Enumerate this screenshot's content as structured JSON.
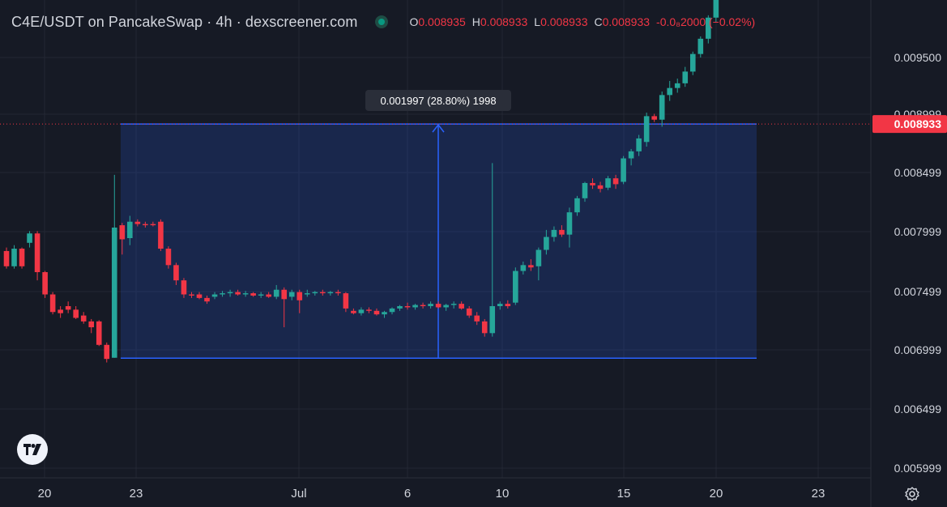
{
  "header": {
    "title": "C4E/USDT on PancakeSwap · 4h · dexscreener.com",
    "ohlc": {
      "o_label": "O",
      "o": "0.008935",
      "h_label": "H",
      "h": "0.008933",
      "l_label": "L",
      "l": "0.008933",
      "c_label": "C",
      "c": "0.008933",
      "change": "-0.0₈2000 (−0.02%)"
    }
  },
  "measure_label": "0.001997 (28.80%) 1998",
  "price_badge": "0.008933",
  "colors": {
    "background": "#161a25",
    "up": "#26a69a",
    "down": "#f23645",
    "measure": "#2962ff",
    "badge": "#f23645"
  },
  "icons": {
    "logo": "tradingview-logo-icon",
    "settings": "gear-icon"
  },
  "chart_data": {
    "type": "candlestick",
    "y_ticks": [
      "0.009500",
      "0.008999",
      "0.008499",
      "0.007999",
      "0.007499",
      "0.006999",
      "0.006499",
      "0.005999"
    ],
    "x_ticks": [
      "20",
      "23",
      "Jul",
      "6",
      "10",
      "15",
      "20",
      "23"
    ],
    "last_price": 0.008933,
    "measure": {
      "low": 0.006936,
      "high": 0.008933,
      "change": 0.001997,
      "percent": 28.8,
      "bars": 1998
    },
    "candles": [
      [
        0.00785,
        0.00788,
        0.0077,
        0.00772
      ],
      [
        0.00772,
        0.0079,
        0.0077,
        0.00787
      ],
      [
        0.00787,
        0.00788,
        0.0077,
        0.00772
      ],
      [
        0.00792,
        0.00802,
        0.00788,
        0.008
      ],
      [
        0.008,
        0.00802,
        0.0076,
        0.00767
      ],
      [
        0.00767,
        0.00768,
        0.00745,
        0.00748
      ],
      [
        0.00748,
        0.0075,
        0.00731,
        0.00733
      ],
      [
        0.00735,
        0.00738,
        0.00728,
        0.00732
      ],
      [
        0.00738,
        0.00742,
        0.00732,
        0.00735
      ],
      [
        0.00735,
        0.00738,
        0.00727,
        0.00728
      ],
      [
        0.0073,
        0.00733,
        0.00723,
        0.00725
      ],
      [
        0.00725,
        0.00727,
        0.00715,
        0.0072
      ],
      [
        0.00725,
        0.00726,
        0.00704,
        0.00705
      ],
      [
        0.00705,
        0.00707,
        0.0069,
        0.00693
      ],
      [
        0.00694,
        0.0085,
        0.00694,
        0.00805
      ],
      [
        0.00807,
        0.00809,
        0.00782,
        0.00795
      ],
      [
        0.00796,
        0.00815,
        0.0079,
        0.0081
      ],
      [
        0.0081,
        0.00812,
        0.00806,
        0.00808
      ],
      [
        0.00808,
        0.0081,
        0.00805,
        0.00807
      ],
      [
        0.00808,
        0.0081,
        0.00806,
        0.00807
      ],
      [
        0.0081,
        0.00812,
        0.00785,
        0.00787
      ],
      [
        0.00787,
        0.00789,
        0.0077,
        0.00773
      ],
      [
        0.00773,
        0.00775,
        0.00756,
        0.0076
      ],
      [
        0.0076,
        0.00762,
        0.00745,
        0.00748
      ],
      [
        0.00748,
        0.0075,
        0.00745,
        0.00747
      ],
      [
        0.00748,
        0.0075,
        0.00744,
        0.00745
      ],
      [
        0.00745,
        0.00747,
        0.0074,
        0.00742
      ],
      [
        0.00746,
        0.0075,
        0.00744,
        0.00748
      ],
      [
        0.00748,
        0.00751,
        0.00746,
        0.00749
      ],
      [
        0.00749,
        0.00752,
        0.00746,
        0.0075
      ],
      [
        0.0075,
        0.00752,
        0.00747,
        0.00748
      ],
      [
        0.00748,
        0.00751,
        0.00746,
        0.00749
      ],
      [
        0.00749,
        0.0075,
        0.00746,
        0.00747
      ],
      [
        0.00747,
        0.0075,
        0.00745,
        0.00748
      ],
      [
        0.00748,
        0.0075,
        0.00745,
        0.00746
      ],
      [
        0.00746,
        0.00756,
        0.00744,
        0.00752
      ],
      [
        0.00752,
        0.00754,
        0.0072,
        0.00744
      ],
      [
        0.00746,
        0.00752,
        0.00743,
        0.0075
      ],
      [
        0.0075,
        0.00752,
        0.00732,
        0.00743
      ],
      [
        0.00748,
        0.00752,
        0.00746,
        0.00749
      ],
      [
        0.00749,
        0.00751,
        0.00747,
        0.0075
      ],
      [
        0.0075,
        0.00752,
        0.00747,
        0.00749
      ],
      [
        0.00749,
        0.00751,
        0.00747,
        0.0075
      ],
      [
        0.0075,
        0.00752,
        0.00747,
        0.00749
      ],
      [
        0.00749,
        0.0075,
        0.00733,
        0.00736
      ],
      [
        0.00734,
        0.00736,
        0.00731,
        0.00732
      ],
      [
        0.00732,
        0.00737,
        0.0073,
        0.00735
      ],
      [
        0.00735,
        0.00737,
        0.00732,
        0.00734
      ],
      [
        0.00734,
        0.00736,
        0.0073,
        0.00731
      ],
      [
        0.00731,
        0.00734,
        0.00728,
        0.00733
      ],
      [
        0.00733,
        0.00737,
        0.00731,
        0.00736
      ],
      [
        0.00736,
        0.00739,
        0.00734,
        0.00738
      ],
      [
        0.00738,
        0.00741,
        0.00735,
        0.00737
      ],
      [
        0.00737,
        0.0074,
        0.00735,
        0.00739
      ],
      [
        0.00739,
        0.00741,
        0.00736,
        0.00738
      ],
      [
        0.00738,
        0.00742,
        0.00736,
        0.0074
      ],
      [
        0.0074,
        0.00742,
        0.00736,
        0.00737
      ],
      [
        0.00737,
        0.0074,
        0.00734,
        0.00739
      ],
      [
        0.00739,
        0.00742,
        0.00736,
        0.0074
      ],
      [
        0.0074,
        0.00742,
        0.00735,
        0.00736
      ],
      [
        0.00736,
        0.00738,
        0.00728,
        0.0073
      ],
      [
        0.0073,
        0.00733,
        0.00722,
        0.00725
      ],
      [
        0.00725,
        0.00727,
        0.00712,
        0.00715
      ],
      [
        0.00715,
        0.0086,
        0.00712,
        0.00738
      ],
      [
        0.00738,
        0.00742,
        0.00735,
        0.0074
      ],
      [
        0.0074,
        0.00743,
        0.00736,
        0.00738
      ],
      [
        0.00741,
        0.00771,
        0.00739,
        0.00768
      ],
      [
        0.00768,
        0.00776,
        0.00765,
        0.00773
      ],
      [
        0.00773,
        0.00778,
        0.00768,
        0.00771
      ],
      [
        0.00772,
        0.00788,
        0.0076,
        0.00786
      ],
      [
        0.00786,
        0.00803,
        0.00782,
        0.00797
      ],
      [
        0.00797,
        0.00806,
        0.00793,
        0.00803
      ],
      [
        0.00803,
        0.00807,
        0.00797,
        0.00799
      ],
      [
        0.00799,
        0.00822,
        0.00788,
        0.00818
      ],
      [
        0.00818,
        0.00832,
        0.00815,
        0.0083
      ],
      [
        0.0083,
        0.00844,
        0.00827,
        0.00843
      ],
      [
        0.00843,
        0.00847,
        0.00838,
        0.00841
      ],
      [
        0.00841,
        0.00844,
        0.00835,
        0.00838
      ],
      [
        0.00839,
        0.00849,
        0.00837,
        0.00847
      ],
      [
        0.00847,
        0.0085,
        0.00838,
        0.00842
      ],
      [
        0.00844,
        0.00866,
        0.00842,
        0.00864
      ],
      [
        0.00864,
        0.00872,
        0.00858,
        0.0087
      ],
      [
        0.0087,
        0.00884,
        0.00866,
        0.00881
      ],
      [
        0.00878,
        0.00903,
        0.00874,
        0.009
      ],
      [
        0.009,
        0.00902,
        0.00895,
        0.00897
      ],
      [
        0.00897,
        0.00921,
        0.00891,
        0.00918
      ],
      [
        0.00918,
        0.0093,
        0.00913,
        0.00924
      ],
      [
        0.00924,
        0.00932,
        0.0092,
        0.00928
      ],
      [
        0.00928,
        0.00942,
        0.00925,
        0.00938
      ],
      [
        0.00938,
        0.00955,
        0.00935,
        0.00953
      ],
      [
        0.00953,
        0.00968,
        0.0095,
        0.00966
      ],
      [
        0.00966,
        0.00986,
        0.00962,
        0.00984
      ],
      [
        0.00984,
        0.01016,
        0.0098,
        0.01014
      ],
      [
        0.01014,
        0.01022,
        0.01008,
        0.01012
      ],
      [
        0.01012,
        0.01015,
        0.01006,
        0.0101
      ]
    ]
  }
}
